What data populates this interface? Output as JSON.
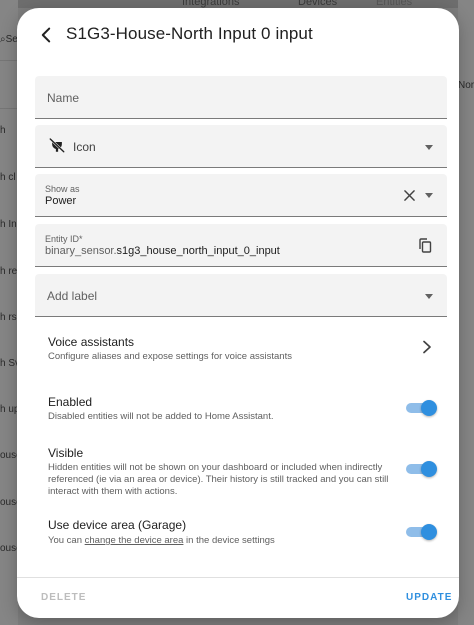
{
  "background": {
    "top_tabs": [
      "Integrations",
      "Devices",
      "Entities"
    ],
    "search_fragment": "Se",
    "left_rows": [
      "h",
      "h cl",
      "h In",
      "h re",
      "h rs",
      "h Sv",
      "h up",
      "ouse",
      "ouse",
      "ouse"
    ],
    "right_fragment": "Nor"
  },
  "dialog": {
    "title": "S1G3-House-North Input 0 input",
    "name_field": {
      "label": "Name",
      "value": ""
    },
    "icon_field": {
      "label": "Icon"
    },
    "show_as": {
      "label": "Show as",
      "value": "Power"
    },
    "entity_id": {
      "label": "Entity ID*",
      "prefix": "binary_sensor.",
      "value": "s1g3_house_north_input_0_input"
    },
    "add_label": {
      "label": "Add label"
    },
    "voice": {
      "title": "Voice assistants",
      "subtitle": "Configure aliases and expose settings for voice assistants"
    },
    "enabled": {
      "title": "Enabled",
      "subtitle": "Disabled entities will not be added to Home Assistant.",
      "on": true
    },
    "visible": {
      "title": "Visible",
      "subtitle": "Hidden entities will not be shown on your dashboard or included when indirectly referenced (ie via an area or device). Their history is still tracked and you can still interact with them with actions.",
      "on": true
    },
    "device_area": {
      "title": "Use device area (Garage)",
      "subtitle_prefix": "You can ",
      "subtitle_link": "change the device area",
      "subtitle_suffix": " in the device settings",
      "on": true
    },
    "delete_label": "DELETE",
    "update_label": "UPDATE"
  },
  "colors": {
    "accent": "#2f8fdf",
    "accent_track": "#8fbde9",
    "disabled_text": "#bdbdbd",
    "field_bg": "#f3f3f3"
  },
  "icons": {
    "back": "arrow-left-icon",
    "icon_field": "power-plug-off-icon",
    "clear": "close-icon",
    "copy": "content-copy-icon",
    "chevron": "chevron-right-icon"
  }
}
